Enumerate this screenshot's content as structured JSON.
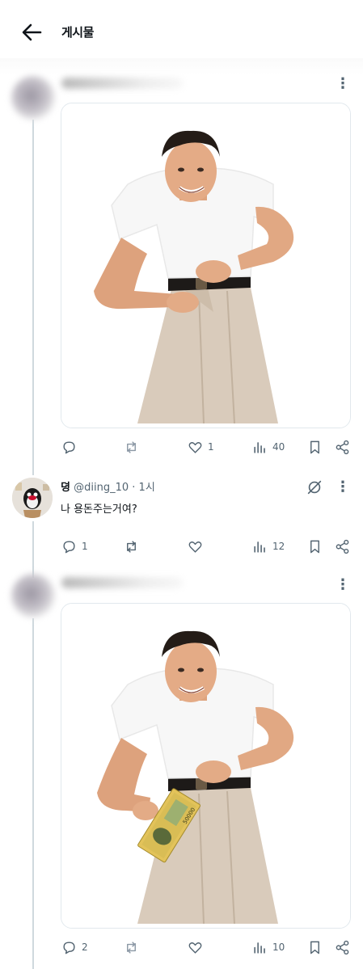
{
  "header": {
    "title": "게시물",
    "back_icon": "back-arrow-icon"
  },
  "posts": [
    {
      "stats": {
        "replies": "",
        "reposts": "",
        "likes": "1",
        "views": "40"
      }
    },
    {
      "author": {
        "name": "뎡",
        "handle": "@diing_10",
        "separator": "·",
        "time": "1시"
      },
      "text": "나 용돈주는거여?",
      "stats": {
        "replies": "1",
        "reposts": "",
        "likes": "",
        "views": "12"
      }
    },
    {
      "stats": {
        "replies": "2",
        "reposts": "",
        "likes": "",
        "views": "10"
      }
    }
  ],
  "colors": {
    "text": "#0f1419",
    "muted": "#536471",
    "thread_line": "#cfd9de",
    "border": "#e1e8ed"
  }
}
